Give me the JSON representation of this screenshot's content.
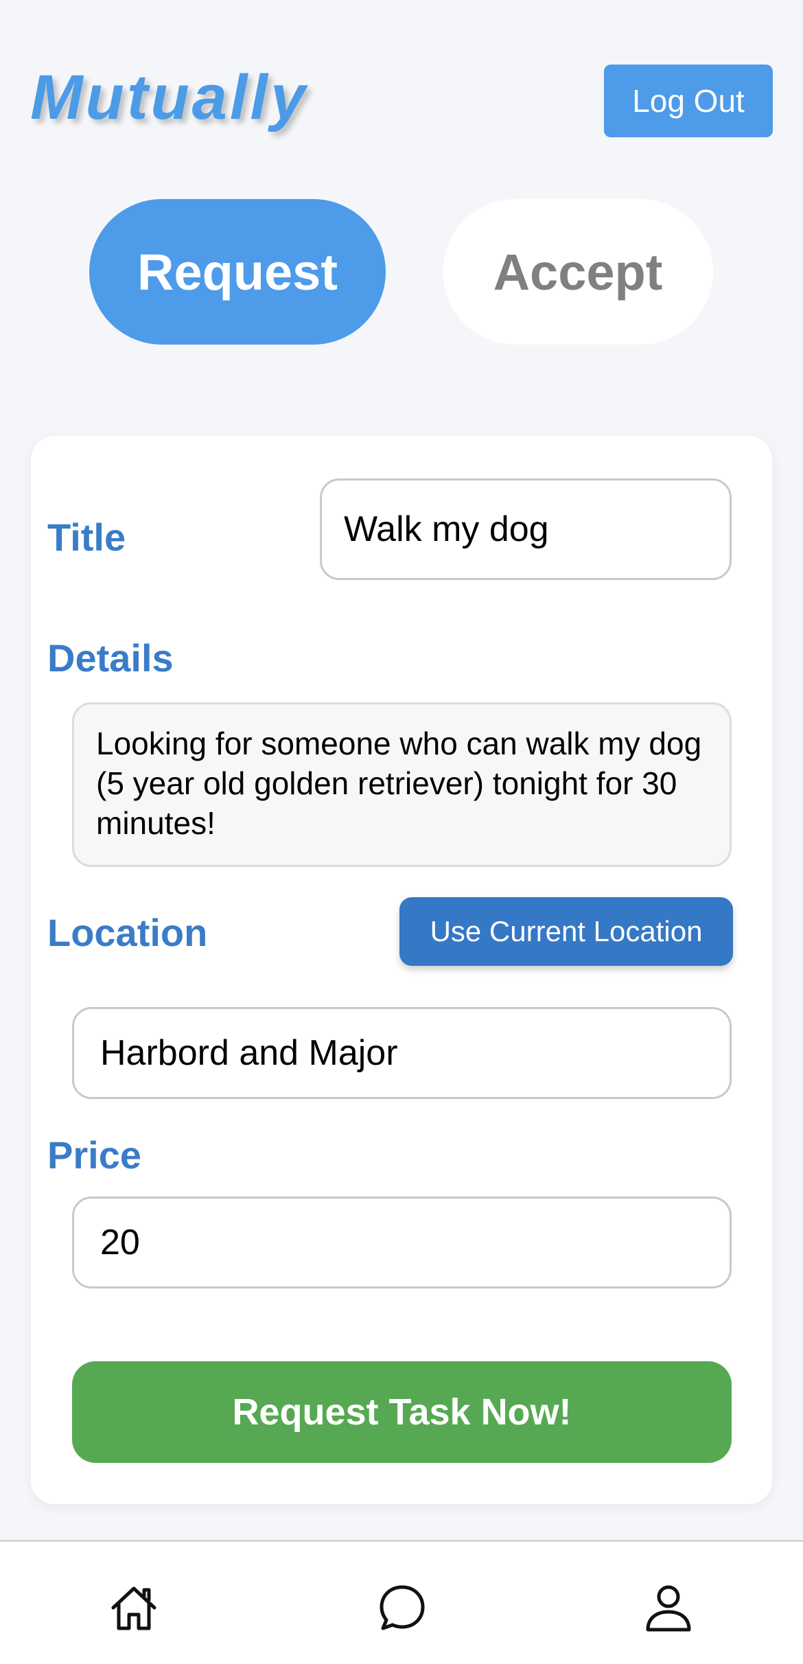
{
  "header": {
    "logo": "Mutually",
    "logout_label": "Log Out"
  },
  "tabs": [
    {
      "label": "Request",
      "selected": true
    },
    {
      "label": "Accept",
      "selected": false
    }
  ],
  "form": {
    "title_label": "Title",
    "title_value": "Walk my dog",
    "details_label": "Details",
    "details_value": "Looking for someone who can walk my dog (5 year old golden retriever) tonight for 30 minutes!",
    "location_label": "Location",
    "use_location_label": "Use Current Location",
    "location_value": "Harbord and Major",
    "price_label": "Price",
    "price_value": "20",
    "submit_label": "Request Task Now!"
  },
  "bottom_nav": [
    {
      "icon": "home-icon"
    },
    {
      "icon": "chat-icon"
    },
    {
      "icon": "profile-icon"
    }
  ],
  "colors": {
    "accent": "#4d9be9",
    "label_blue": "#3a7cc7",
    "location_button": "#3578c6",
    "submit_green": "#57a853"
  }
}
